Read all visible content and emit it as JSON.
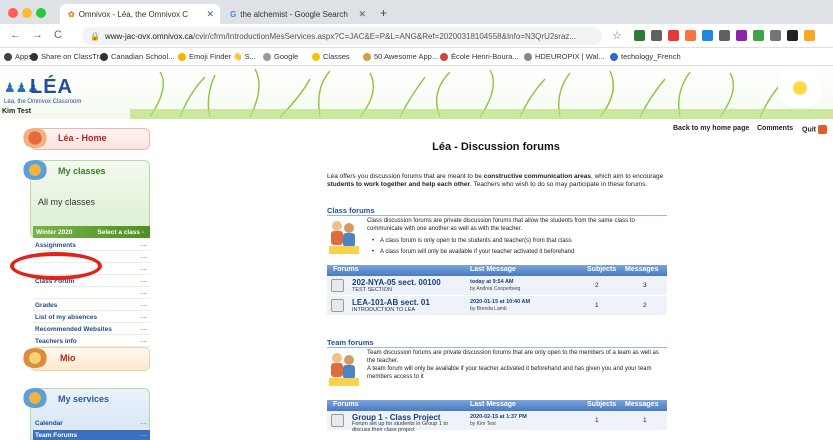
{
  "browser": {
    "tabs": [
      {
        "title": "Omnivox - Léa, the Omnivox C",
        "active": true
      },
      {
        "title": "the alchemist - Google Search",
        "active": false
      }
    ],
    "new_tab_symbol": "+",
    "url_host": "www-jac-ovx.omnivox.ca",
    "url_path": "/cvir/cfrm/IntroductionMesServices.aspx?C=JAC&E=P&L=ANG&Ref=20200318104558&Info=N3QrU2sraz...",
    "nav": {
      "back": "←",
      "forward": "→",
      "reload": "C"
    },
    "bookmarks": [
      {
        "label": "Apps",
        "color": "#444444"
      },
      {
        "label": "Share on ClassTrak",
        "color": "#333333"
      },
      {
        "label": "Canadian School...",
        "color": "#333333"
      },
      {
        "label": "Emoji Finder 👋 S...",
        "color": "#f5b400"
      },
      {
        "label": "Google",
        "color": "#999999"
      },
      {
        "label": "Classes",
        "color": "#f5c400"
      },
      {
        "label": "50 Awesome App...",
        "color": "#d2a040"
      },
      {
        "label": "École Henri-Boura...",
        "color": "#cc4444"
      },
      {
        "label": "HDEUROPIX | Wal...",
        "color": "#888888"
      },
      {
        "label": "techology_French",
        "color": "#3366cc"
      }
    ],
    "extension_colors": [
      "#2e7d32",
      "#616161",
      "#e53935",
      "#ff7043",
      "#1e88e5",
      "#616161",
      "#8e24aa",
      "#43a047",
      "#757575",
      "#212121",
      "#f9a825"
    ]
  },
  "header": {
    "logo": "LÉA",
    "logo_subtitle": "Léa, the Omnivox Classroom",
    "user": "Kim Test"
  },
  "sidebar": {
    "lea_home": "Léa - Home",
    "my_classes": "My classes",
    "all_classes": "All my classes",
    "term": "Winter 2020",
    "select_class": "Select a class -",
    "items": [
      {
        "label": "Assignments",
        "dots": "...."
      },
      {
        "label": "",
        "dots": "...."
      },
      {
        "label": "",
        "dots": "...."
      },
      {
        "label": "Class Forum",
        "dots": "...."
      },
      {
        "label": "",
        "dots": "...."
      },
      {
        "label": "Grades",
        "dots": "...."
      },
      {
        "label": "List of my absences",
        "dots": "...."
      },
      {
        "label": "Recommended Websites",
        "dots": "...."
      },
      {
        "label": "Teachers info",
        "dots": "...."
      }
    ],
    "mio": "Mio",
    "my_services": "My services",
    "service_items": [
      {
        "label": "Calendar",
        "dots": "...."
      },
      {
        "label": "Team Forums",
        "dots": "...."
      }
    ]
  },
  "toplinks": {
    "back_home": "Back to my home page",
    "comments": "Comments",
    "quit": "Quit"
  },
  "main": {
    "title": "Léa - Discussion forums",
    "intro_html_parts": {
      "p1": "Léa offers you discussion forums that are meant to be ",
      "b1": "constructive communication areas",
      "p2": ", which aim to encourage ",
      "b2": "students to work together and help each other",
      "p3": ". Teachers who wish to do so may participate in these forums."
    },
    "class_forums": {
      "title": "Class forums",
      "desc": "Class discussion forums are private discussion forums that allow the students from the same class to communicate with one another as well as with the teacher.",
      "bullets": [
        "A class forum is only open to the students and teacher(s) from that class",
        "A class forum will only be available if your teacher activated it beforehand"
      ],
      "headers": {
        "forums": "Forums",
        "last": "Last Message",
        "subjects": "Subjects",
        "messages": "Messages"
      },
      "rows": [
        {
          "name": "202-NYA-05 sect. 00100",
          "sub": "TEST SECTION",
          "date": "today at 9:54 AM",
          "by": "by Andrea Cooperberg",
          "subjects": "2",
          "messages": "3"
        },
        {
          "name": "LEA-101-AB sect. 01",
          "sub": "INTRODUCTION TO LEA",
          "date": "2020-01-15 at 10:40 AM",
          "by": "by Brenda Lamb",
          "subjects": "1",
          "messages": "2"
        }
      ]
    },
    "team_forums": {
      "title": "Team forums",
      "desc1": "Team discussion forums are private discussion forums that are only open to the members of a team as well as the teacher.",
      "desc2": "A team forum will only be available if your teacher activated it beforehand and has given you and your team members access to it",
      "headers": {
        "forums": "Forums",
        "last": "Last Message",
        "subjects": "Subjects",
        "messages": "Messages"
      },
      "rows": [
        {
          "name": "Group 1 - Class Project",
          "sub": "Forum set up for students in Group 1 to discuss their class project",
          "date": "2020-02-15 at 1:37 PM",
          "by": "by Kim Test",
          "subjects": "1",
          "messages": "1"
        }
      ]
    }
  },
  "colors": {
    "red_annotation": "#e2231a",
    "forum_header": "#4a7ac2",
    "section_title": "#23509a"
  }
}
